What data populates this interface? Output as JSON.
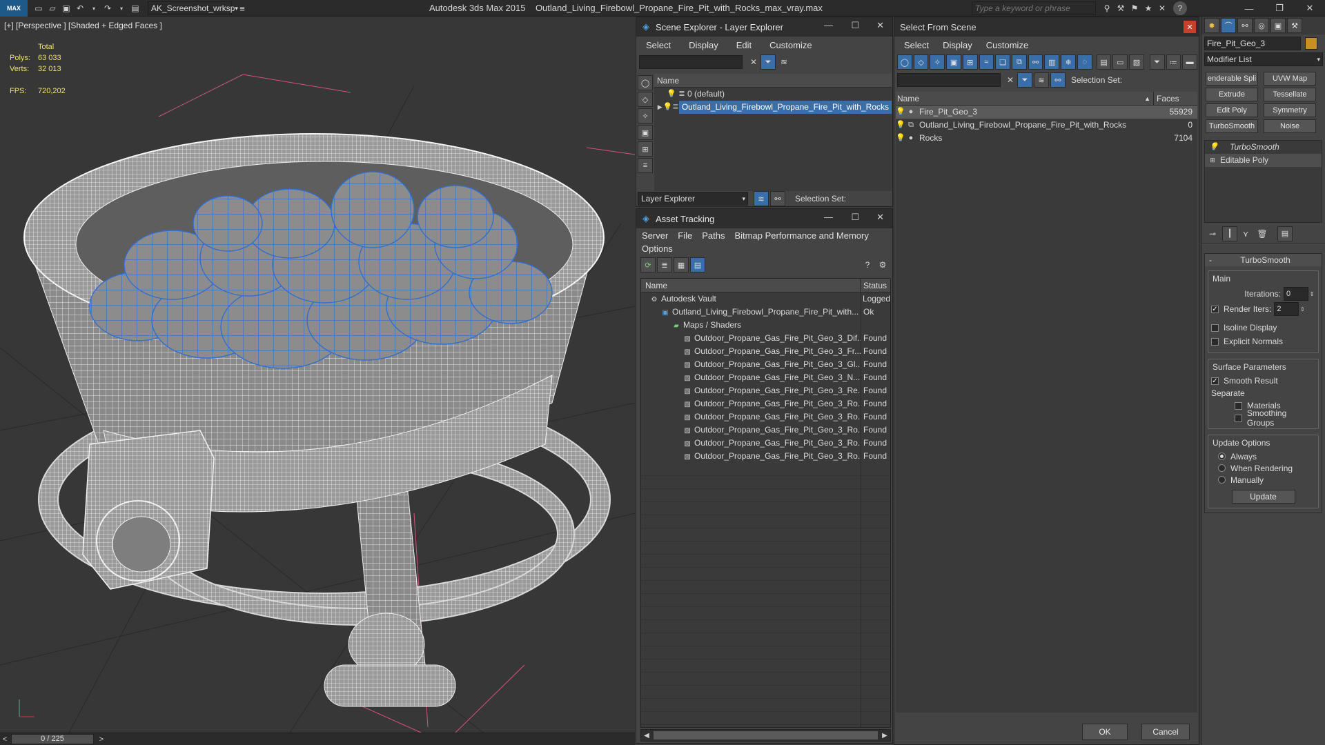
{
  "titlebar": {
    "workspace": "AK_Screenshot_wrksp",
    "app_title": "Autodesk 3ds Max  2015",
    "file_name": "Outland_Living_Firebowl_Propane_Fire_Pit_with_Rocks_max_vray.max",
    "search_placeholder": "Type a keyword or phrase",
    "logo": "MAX"
  },
  "viewport": {
    "label": "[+] [Perspective ] [Shaded + Edged Faces ]",
    "stats": {
      "total_label": "Total",
      "polys_label": "Polys:",
      "polys_value": "63 033",
      "verts_label": "Verts:",
      "verts_value": "32 013",
      "fps_label": "FPS:",
      "fps_value": "720,202"
    }
  },
  "timebar": {
    "frame": "0 / 225",
    "prev": "<",
    "next": ">"
  },
  "scene_explorer": {
    "title": "Scene Explorer - Layer Explorer",
    "menu": [
      "Select",
      "Display",
      "Edit",
      "Customize"
    ],
    "col_name": "Name",
    "rows": [
      "0 (default)",
      "Outland_Living_Firebowl_Propane_Fire_Pit_with_Rocks"
    ],
    "footer_dropdown": "Layer Explorer",
    "selection_set": "Selection Set:"
  },
  "asset_tracking": {
    "title": "Asset Tracking",
    "menu": [
      "Server",
      "File",
      "Paths",
      "Bitmap Performance and Memory"
    ],
    "menu2": "Options",
    "col_name": "Name",
    "col_status": "Status",
    "rows": [
      {
        "name": "Autodesk Vault",
        "status": "Logged",
        "indent": 0
      },
      {
        "name": "Outland_Living_Firebowl_Propane_Fire_Pit_with...",
        "status": "Ok",
        "indent": 1
      },
      {
        "name": "Maps / Shaders",
        "status": "",
        "indent": 2
      },
      {
        "name": "Outdoor_Propane_Gas_Fire_Pit_Geo_3_Dif...",
        "status": "Found",
        "indent": 3
      },
      {
        "name": "Outdoor_Propane_Gas_Fire_Pit_Geo_3_Fr...",
        "status": "Found",
        "indent": 3
      },
      {
        "name": "Outdoor_Propane_Gas_Fire_Pit_Geo_3_Gl...",
        "status": "Found",
        "indent": 3
      },
      {
        "name": "Outdoor_Propane_Gas_Fire_Pit_Geo_3_N...",
        "status": "Found",
        "indent": 3
      },
      {
        "name": "Outdoor_Propane_Gas_Fire_Pit_Geo_3_Re...",
        "status": "Found",
        "indent": 3
      },
      {
        "name": "Outdoor_Propane_Gas_Fire_Pit_Geo_3_Ro...",
        "status": "Found",
        "indent": 3
      },
      {
        "name": "Outdoor_Propane_Gas_Fire_Pit_Geo_3_Ro...",
        "status": "Found",
        "indent": 3
      },
      {
        "name": "Outdoor_Propane_Gas_Fire_Pit_Geo_3_Ro...",
        "status": "Found",
        "indent": 3
      },
      {
        "name": "Outdoor_Propane_Gas_Fire_Pit_Geo_3_Ro...",
        "status": "Found",
        "indent": 3
      },
      {
        "name": "Outdoor_Propane_Gas_Fire_Pit_Geo_3_Ro...",
        "status": "Found",
        "indent": 3
      }
    ]
  },
  "select_from_scene": {
    "title": "Select From Scene",
    "menu": [
      "Select",
      "Display",
      "Customize"
    ],
    "selection_set": "Selection Set:",
    "col_name": "Name",
    "col_faces": "Faces",
    "rows": [
      {
        "name": "Fire_Pit_Geo_3",
        "faces": "55929"
      },
      {
        "name": "Outland_Living_Firebowl_Propane_Fire_Pit_with_Rocks",
        "faces": "0"
      },
      {
        "name": "Rocks",
        "faces": "7104"
      }
    ],
    "ok": "OK",
    "cancel": "Cancel"
  },
  "command_panel": {
    "object_name": "Fire_Pit_Geo_3",
    "modifier_list": "Modifier List",
    "buttons": [
      "enderable Spli",
      "UVW Map",
      "Extrude",
      "Tessellate",
      "Edit Poly",
      "Symmetry",
      "TurboSmooth",
      "Noise"
    ],
    "stack": [
      "TurboSmooth",
      "Editable Poly"
    ],
    "rollout_title": "TurboSmooth",
    "main_label": "Main",
    "iterations_label": "Iterations:",
    "iterations_value": "0",
    "render_iters_label": "Render Iters:",
    "render_iters_value": "2",
    "isoline": "Isoline Display",
    "explicit_normals": "Explicit Normals",
    "surface_params": "Surface Parameters",
    "smooth_result": "Smooth Result",
    "separate": "Separate",
    "materials": "Materials",
    "smoothing_groups": "Smoothing Groups",
    "update_options": "Update Options",
    "always": "Always",
    "when_rendering": "When Rendering",
    "manually": "Manually",
    "update": "Update"
  },
  "colors": {
    "selection": "#3a6ea8",
    "wire_blue": "#2f6fd0",
    "bulb": "#f0d050"
  }
}
